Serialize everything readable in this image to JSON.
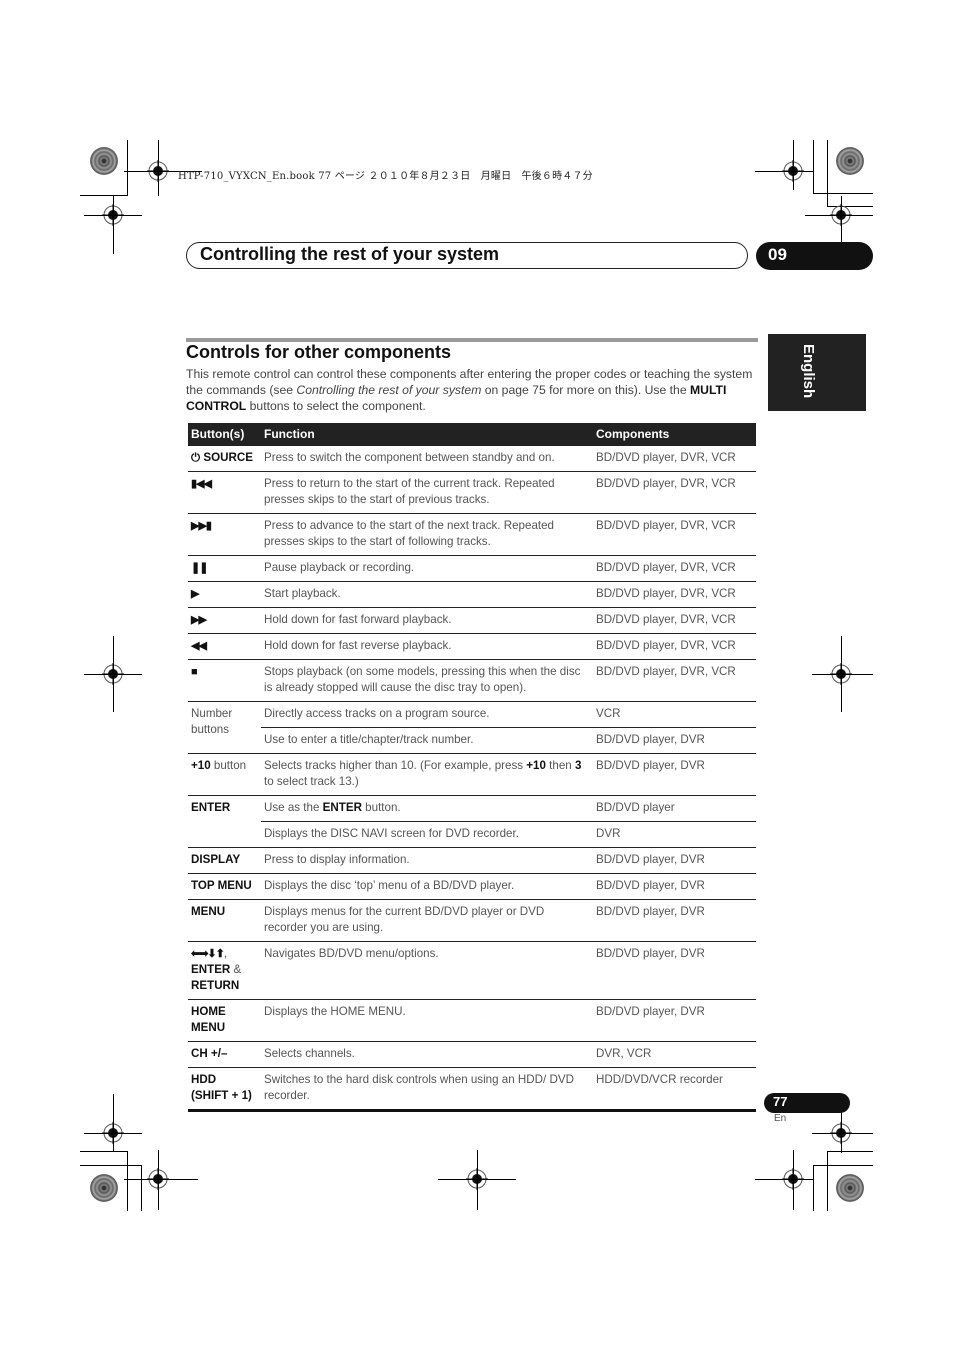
{
  "print_info": "HTP-710_VYXCN_En.book   77 ページ   ２０１０年８月２３日　月曜日　午後６時４７分",
  "chapter": {
    "title": "Controlling the rest of your system",
    "number": "09"
  },
  "side_tab": {
    "language": "English"
  },
  "section": {
    "title": "Controls for other components",
    "intro": {
      "part1": "This remote control can control these components after entering the proper codes or teaching the system the commands (see ",
      "italic_ref": "Controlling the rest of your system",
      "part2": " on page 75 for more on this). Use the ",
      "bold": "MULTI CONTROL",
      "part3": " buttons to select the component."
    }
  },
  "table": {
    "headers": [
      "Button(s)",
      "Function",
      "Components"
    ],
    "rows": [
      {
        "button": "SOURCE",
        "icon": "power-icon",
        "function": "Press to switch the component between standby and on.",
        "components": "BD/DVD player, DVR, VCR"
      },
      {
        "button": "⏮",
        "icon": "previous-track-icon",
        "function": "Press to return to the start of the current track. Repeated presses skips to the start of previous tracks.",
        "components": "BD/DVD player, DVR, VCR"
      },
      {
        "button": "⏭",
        "icon": "next-track-icon",
        "function": "Press to advance to the start of the next track. Repeated presses skips to the start of following tracks.",
        "components": "BD/DVD player, DVR, VCR"
      },
      {
        "button": "❚❚",
        "icon": "pause-icon",
        "function": "Pause playback or recording.",
        "components": "BD/DVD player, DVR, VCR"
      },
      {
        "button": "▶",
        "icon": "play-icon",
        "function": "Start playback.",
        "components": "BD/DVD player, DVR, VCR"
      },
      {
        "button": "▶▶",
        "icon": "fast-forward-icon",
        "function": "Hold down for fast forward playback.",
        "components": "BD/DVD player, DVR, VCR"
      },
      {
        "button": "◀◀",
        "icon": "rewind-icon",
        "function": "Hold down for fast reverse playback.",
        "components": "BD/DVD player, DVR, VCR"
      },
      {
        "button": "■",
        "icon": "stop-icon",
        "function": "Stops playback (on some models, pressing this when the disc is already stopped will cause the disc tray to open).",
        "components": "BD/DVD player, DVR, VCR"
      },
      {
        "button": "Number buttons",
        "function": "Directly access tracks on a program source.",
        "components": "VCR"
      },
      {
        "button": "",
        "function": "Use to enter a title/chapter/track number.",
        "components": "BD/DVD player, DVR"
      },
      {
        "button_bold": "+10",
        "button_plain": " button",
        "function_parts": [
          "Selects tracks higher than 10. (For example, press ",
          "+10",
          " then ",
          "3",
          " to select track 13.)"
        ],
        "components": "BD/DVD player, DVR"
      },
      {
        "button": "ENTER",
        "function_parts": [
          "Use as the ",
          "ENTER",
          " button."
        ],
        "components": "BD/DVD player"
      },
      {
        "button": "",
        "function": "Displays the DISC NAVI screen for DVD recorder.",
        "components": "DVR"
      },
      {
        "button": "DISPLAY",
        "function": "Press to display information.",
        "components": "BD/DVD player, DVR"
      },
      {
        "button": "TOP MENU",
        "function": "Displays the disc ‘top’ menu of a BD/DVD player.",
        "components": "BD/DVD player, DVR"
      },
      {
        "button": "MENU",
        "function": "Displays menus for the current BD/DVD player or DVD recorder you are using.",
        "components": "BD/DVD player, DVR"
      },
      {
        "button_arrows": "⬅➡⬇⬆",
        "button_line2": "ENTER",
        "button_amp": " &",
        "button_line3": "RETURN",
        "function": "Navigates BD/DVD menu/options.",
        "components": "BD/DVD player, DVR"
      },
      {
        "button": "HOME MENU",
        "function": "Displays the HOME MENU.",
        "components": "BD/DVD player, DVR"
      },
      {
        "button": "CH +/–",
        "function": "Selects channels.",
        "components": "DVR, VCR"
      },
      {
        "button": "HDD",
        "button_line2": "(SHIFT + 1)",
        "function": "Switches to the hard disk controls when using an HDD/ DVD recorder.",
        "components": "HDD/DVD/VCR recorder"
      }
    ]
  },
  "footer": {
    "page_number": "77",
    "language_code": "En"
  }
}
